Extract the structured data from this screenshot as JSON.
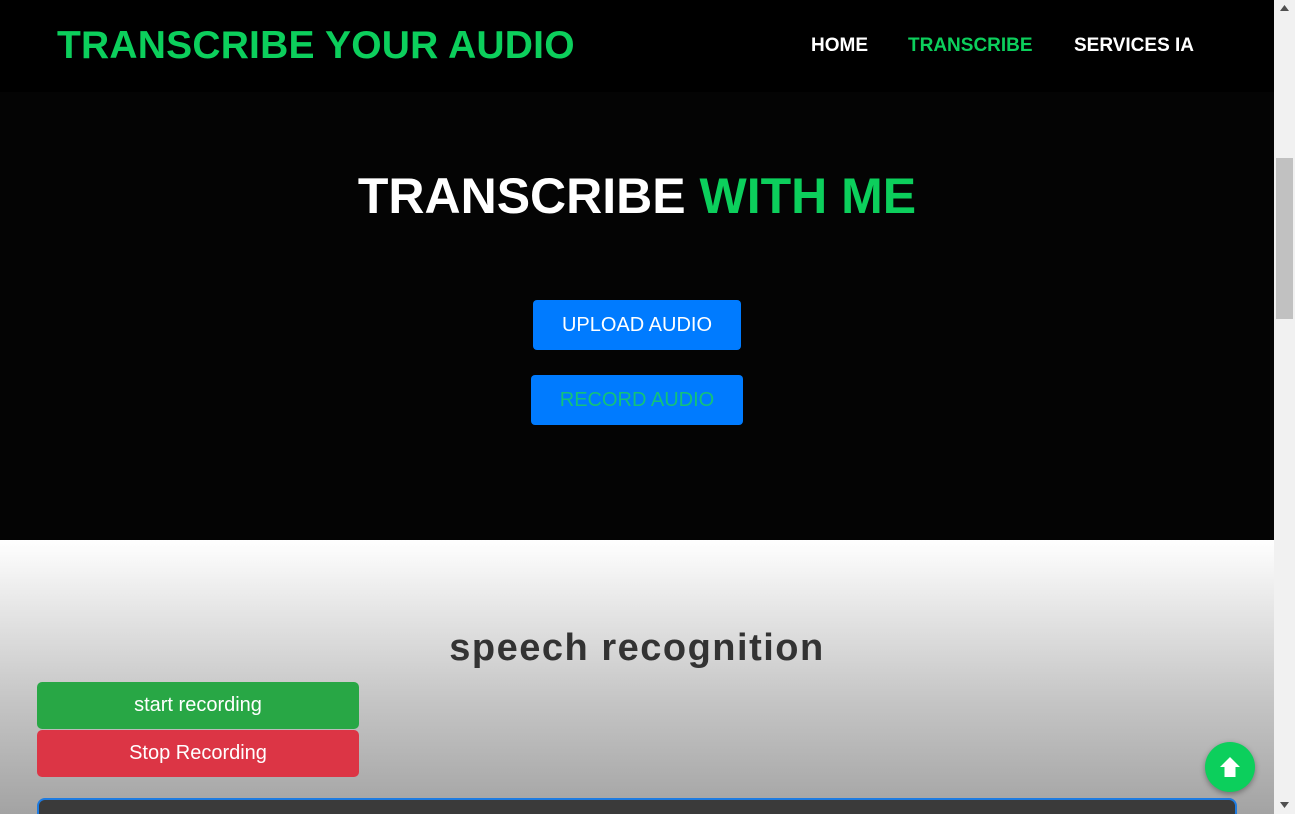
{
  "navbar": {
    "brand": "TRANSCRIBE YOUR AUDIO",
    "links": [
      {
        "label": "HOME",
        "active": false
      },
      {
        "label": "TRANSCRIBE",
        "active": true
      },
      {
        "label": "SERVICES IA",
        "active": false
      }
    ]
  },
  "hero": {
    "title_main": "TRANSCRIBE ",
    "title_accent": "WITH ME",
    "upload_label": "UPLOAD AUDIO",
    "record_label": "RECORD AUDIO"
  },
  "speech": {
    "title": "speech recognition",
    "start_label": "start recording",
    "stop_label": "Stop Recording"
  },
  "icons": {
    "back_to_top": "arrow-up-icon"
  },
  "colors": {
    "accent": "#0ccf5c",
    "primary_button": "#007bff",
    "start_button": "#28a745",
    "stop_button": "#dc3545"
  }
}
